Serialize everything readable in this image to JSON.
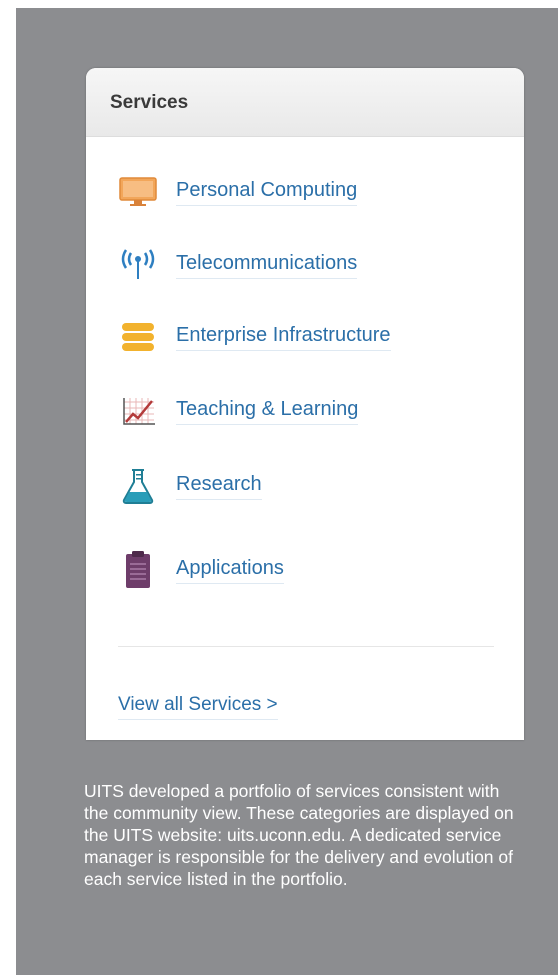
{
  "card": {
    "title": "Services",
    "items": [
      {
        "label": "Personal Computing",
        "icon": "monitor-icon"
      },
      {
        "label": "Telecommunications",
        "icon": "antenna-icon"
      },
      {
        "label": "Enterprise Infrastructure",
        "icon": "database-icon"
      },
      {
        "label": "Teaching & Learning",
        "icon": "line-chart-icon"
      },
      {
        "label": "Research",
        "icon": "flask-icon"
      },
      {
        "label": "Applications",
        "icon": "clipboard-icon"
      }
    ],
    "view_all": "View all Services >"
  },
  "caption": "UITS developed a portfolio of services consistent with the community view. These categories are displayed on the UITS website: uits.uconn.edu. A dedicated service manager is responsible for the delivery and evolution of each service listed in the portfolio.",
  "colors": {
    "background_panel": "#8c8d90",
    "link": "#2b6fa8",
    "monitor": "#f2a65a",
    "antenna": "#2e7fc1",
    "database": "#f2b22d",
    "chart": "#b33a3a",
    "flask": "#2a9db8",
    "clipboard": "#6e3d6a"
  }
}
